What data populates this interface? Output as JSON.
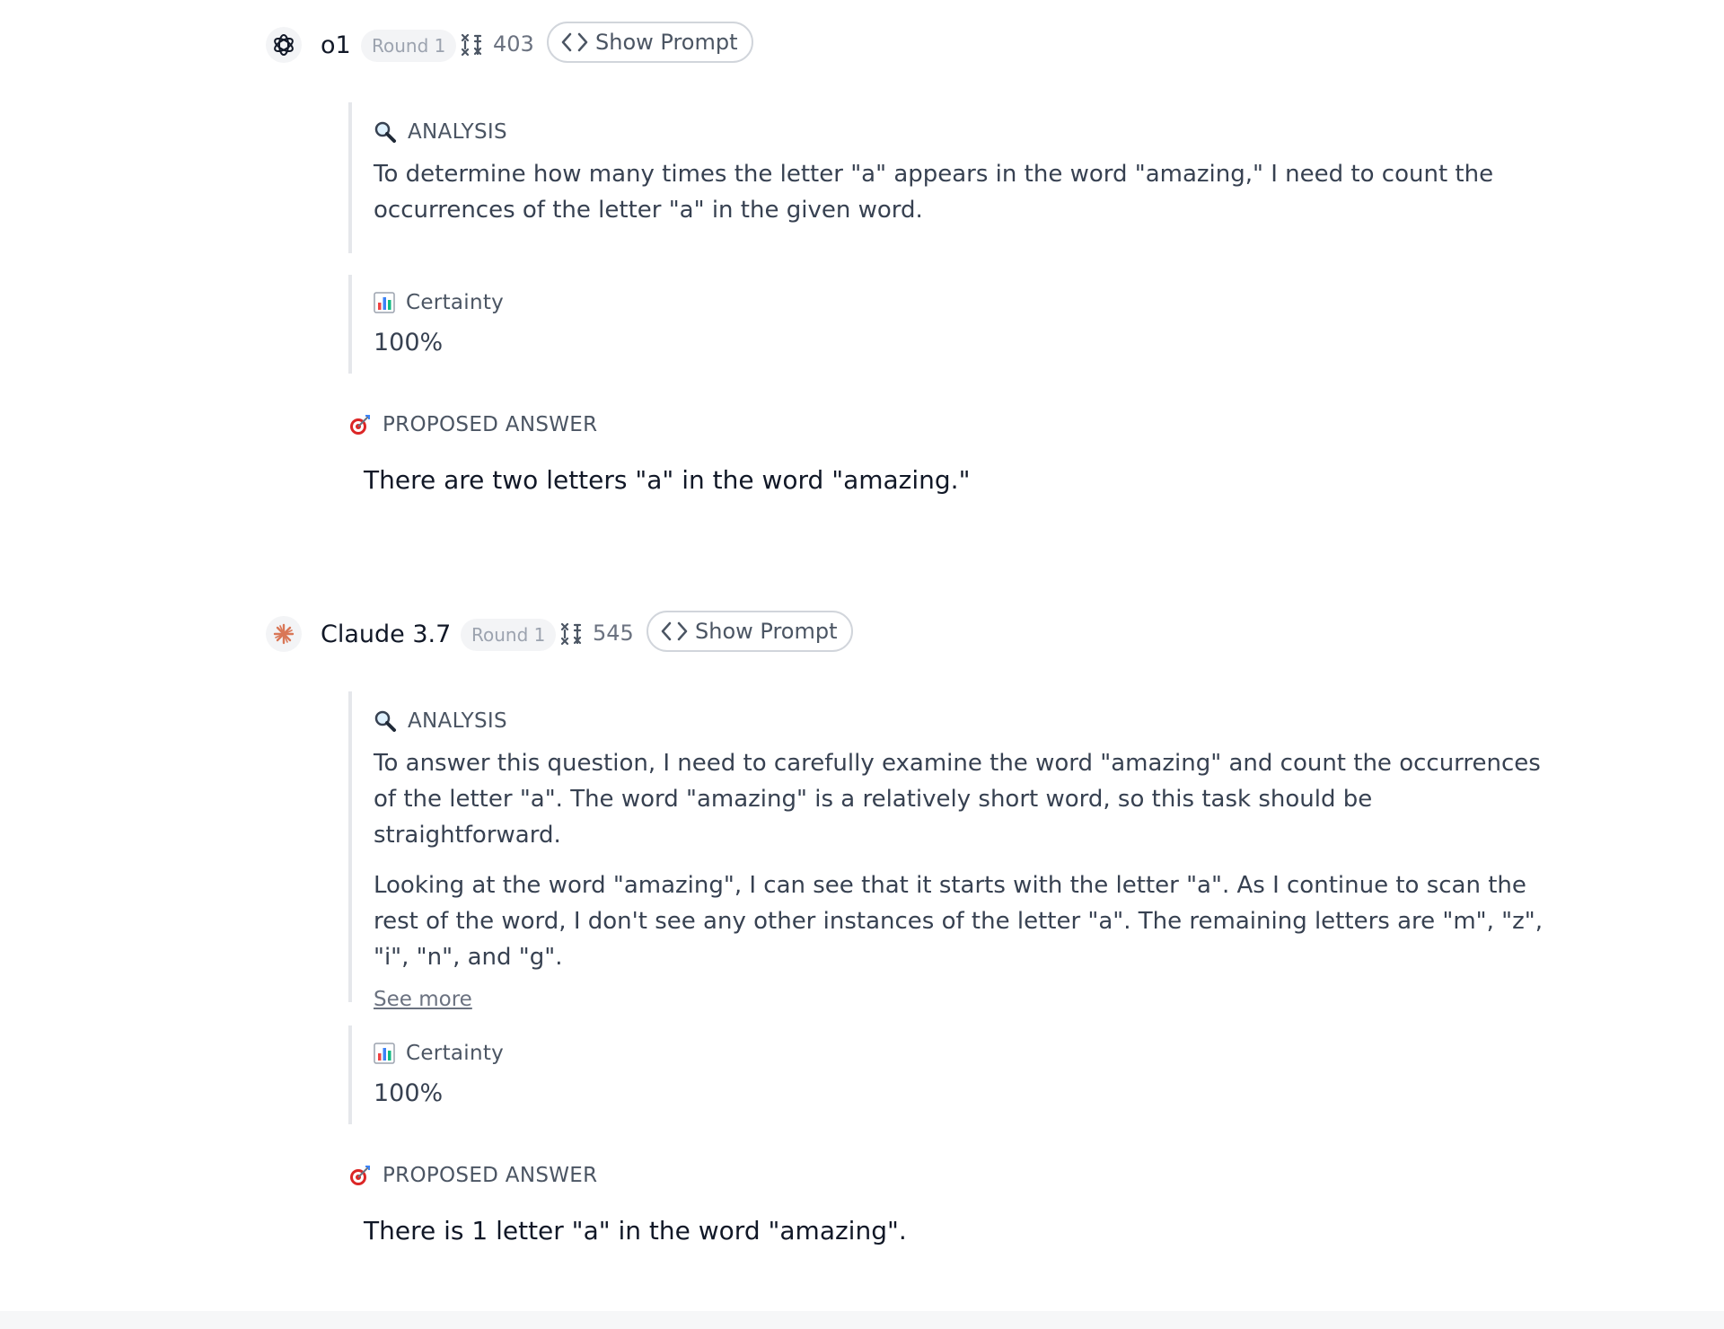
{
  "responses": [
    {
      "model": "o1",
      "round": "Round 1",
      "tokens": "403",
      "show_prompt": "Show Prompt",
      "analysis_label": "ANALYSIS",
      "analysis_paragraphs": [
        "To determine how many times the letter \"a\" appears in the word \"amazing,\" I need to count the occurrences of the letter \"a\" in the given word."
      ],
      "certainty_label": "Certainty",
      "certainty_value": "100%",
      "proposed_label": "PROPOSED ANSWER",
      "answer": "There are two letters \"a\" in the word \"amazing.\""
    },
    {
      "model": "Claude 3.7",
      "round": "Round 1",
      "tokens": "545",
      "show_prompt": "Show Prompt",
      "analysis_label": "ANALYSIS",
      "analysis_paragraphs": [
        "To answer this question, I need to carefully examine the word \"amazing\" and count the occurrences of the letter \"a\". The word \"amazing\" is a relatively short word, so this task should be straightforward.",
        "Looking at the word \"amazing\", I can see that it starts with the letter \"a\". As I continue to scan the rest of the word, I don't see any other instances of the letter \"a\". The remaining letters are \"m\", \"z\", \"i\", \"n\", and \"g\"."
      ],
      "see_more": "See more",
      "certainty_label": "Certainty",
      "certainty_value": "100%",
      "proposed_label": "PROPOSED ANSWER",
      "answer": "There is 1 letter \"a\" in the word \"amazing\"."
    }
  ],
  "icons": {
    "analysis": "magnifying-glass-icon",
    "certainty": "bar-chart-icon",
    "proposed": "target-icon",
    "tokens": "token-icon",
    "show_prompt": "code-icon"
  }
}
